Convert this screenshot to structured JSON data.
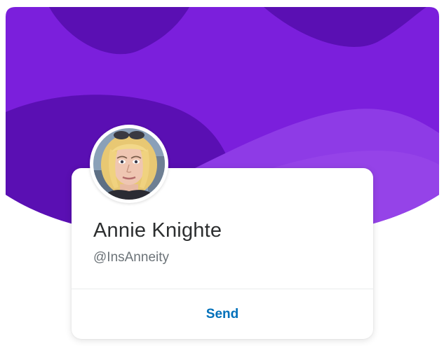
{
  "profile": {
    "name": "Annie Knighte",
    "handle": "@InsAnneity",
    "avatar_description": "profile-photo"
  },
  "actions": {
    "send_label": "Send"
  },
  "colors": {
    "banner_base": "#7b1fdc",
    "banner_dark": "#5a0fb3",
    "banner_light": "#8e3be6",
    "link": "#0070ba",
    "name_text": "#2c2e2f",
    "handle_text": "#6c7378"
  }
}
